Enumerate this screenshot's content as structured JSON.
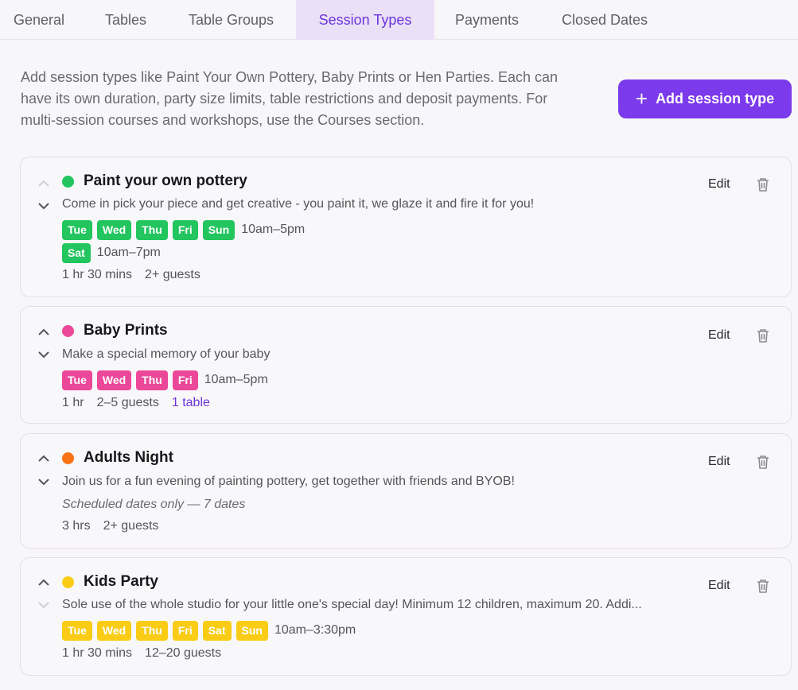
{
  "tabs": [
    {
      "label": "General"
    },
    {
      "label": "Tables"
    },
    {
      "label": "Table Groups"
    },
    {
      "label": "Session Types"
    },
    {
      "label": "Payments"
    },
    {
      "label": "Closed Dates"
    }
  ],
  "intro": {
    "line1": "Add session types like Paint Your Own Pottery, Baby Prints or Hen Parties. Each can",
    "line2": "have its own duration, party size limits, table restrictions and deposit payments. For",
    "line3": "multi-session courses and workshops, use the Courses section."
  },
  "add_button": {
    "icon": "plus-icon",
    "label": "Add session type"
  },
  "colors": {
    "accent": "#7c3aed",
    "green": "#22c55e",
    "pink": "#ec4899",
    "orange": "#f97316",
    "yellow": "#facc15"
  },
  "sessions": [
    {
      "title": "Paint your own pottery",
      "color": "#22c55e",
      "description": "Come in pick your piece and get creative - you paint it, we glaze it and fire it for you!",
      "schedule": [
        {
          "days": [
            "Tue",
            "Wed",
            "Thu",
            "Fri",
            "Sun"
          ],
          "hours": "10am–5pm"
        },
        {
          "days": [
            "Sat"
          ],
          "hours": "10am–7pm"
        }
      ],
      "duration": "1 hr 30 mins",
      "guests": "2+ guests",
      "edit": "Edit"
    },
    {
      "title": "Baby Prints",
      "color": "#ec4899",
      "description": "Make a special memory of your baby",
      "schedule": [
        {
          "days": [
            "Tue",
            "Wed",
            "Thu",
            "Fri"
          ],
          "hours": "10am–5pm"
        }
      ],
      "duration": "1 hr",
      "guests": "2–5 guests",
      "tables": "1 table",
      "edit": "Edit"
    },
    {
      "title": "Adults Night",
      "color": "#f97316",
      "description": "Join us for a fun evening of painting pottery, get together with friends and BYOB!",
      "scheduled_note": "Scheduled dates only — 7 dates",
      "duration": "3 hrs",
      "guests": "2+ guests",
      "edit": "Edit"
    },
    {
      "title": "Kids Party",
      "color": "#facc15",
      "description": "Sole use of the whole studio for your little one's special day! Minimum 12 children, maximum 20. Addi...",
      "schedule": [
        {
          "days": [
            "Tue",
            "Wed",
            "Thu",
            "Fri",
            "Sat",
            "Sun"
          ],
          "hours": "10am–3:30pm"
        }
      ],
      "duration": "1 hr 30 mins",
      "guests": "12–20 guests",
      "edit": "Edit"
    }
  ]
}
